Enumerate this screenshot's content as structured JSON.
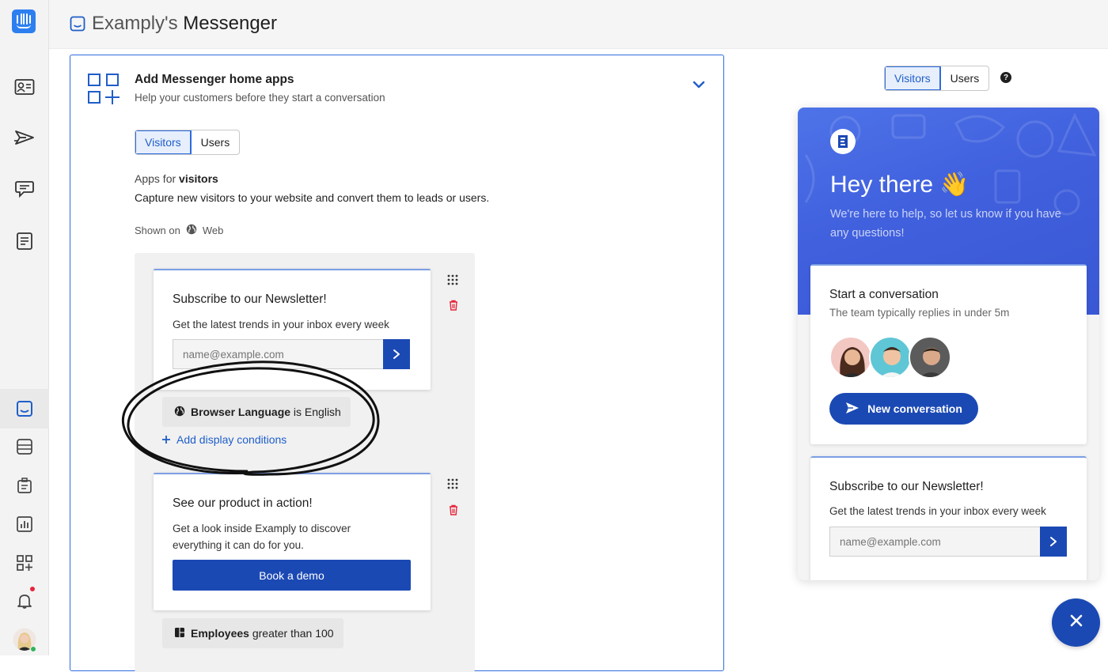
{
  "header": {
    "title_prefix": "Examply's",
    "title_main": "Messenger"
  },
  "card": {
    "title": "Add Messenger home apps",
    "subtitle": "Help your customers before they start a conversation",
    "audience_tabs": [
      {
        "label": "Visitors",
        "selected": true
      },
      {
        "label": "Users",
        "selected": false
      }
    ],
    "apps_for_prefix": "Apps for",
    "apps_for_audience": "visitors",
    "apps_description": "Capture new visitors to your website and convert them to leads or users.",
    "shown_on_label": "Shown on",
    "shown_on_value": "Web",
    "apps": [
      {
        "title": "Subscribe to our Newsletter!",
        "body": "Get the latest trends in your inbox every week",
        "email_placeholder": "name@example.com",
        "condition_attr": "Browser Language",
        "condition_rest": "is English",
        "add_conditions": "Add display conditions"
      },
      {
        "title": "See our product in action!",
        "body_line1": "Get a look inside Examply to discover",
        "body_line2": "everything it can do for you.",
        "button": "Book a demo",
        "condition_attr": "Employees",
        "condition_rest": "greater than 100"
      }
    ]
  },
  "preview": {
    "audience_tabs": [
      {
        "label": "Visitors",
        "selected": true
      },
      {
        "label": "Users",
        "selected": false
      }
    ],
    "help_glyph": "?",
    "greeting": "Hey there 👋",
    "greeting_sub": "We're here to help, so let us know if you have any questions!",
    "conversation_title": "Start a conversation",
    "conversation_sub": "The team typically replies in under 5m",
    "new_conversation": "New conversation",
    "newsletter_title": "Subscribe to our Newsletter!",
    "newsletter_body": "Get the latest trends in your inbox every week",
    "email_placeholder": "name@example.com"
  },
  "colors": {
    "accent": "#1b49b4",
    "link": "#1f5ec9",
    "hero": "#4060de",
    "danger": "#e5253b"
  },
  "icons": [
    "intercom-logo",
    "contacts-icon",
    "outbound-icon",
    "inbox-icon",
    "articles-icon",
    "messenger-icon",
    "reports-icon",
    "operator-icon",
    "chart-icon",
    "apps-icon",
    "bell-icon",
    "globe-icon",
    "grip-icon",
    "trash-icon",
    "chevron-down-icon",
    "send-icon",
    "close-icon"
  ]
}
